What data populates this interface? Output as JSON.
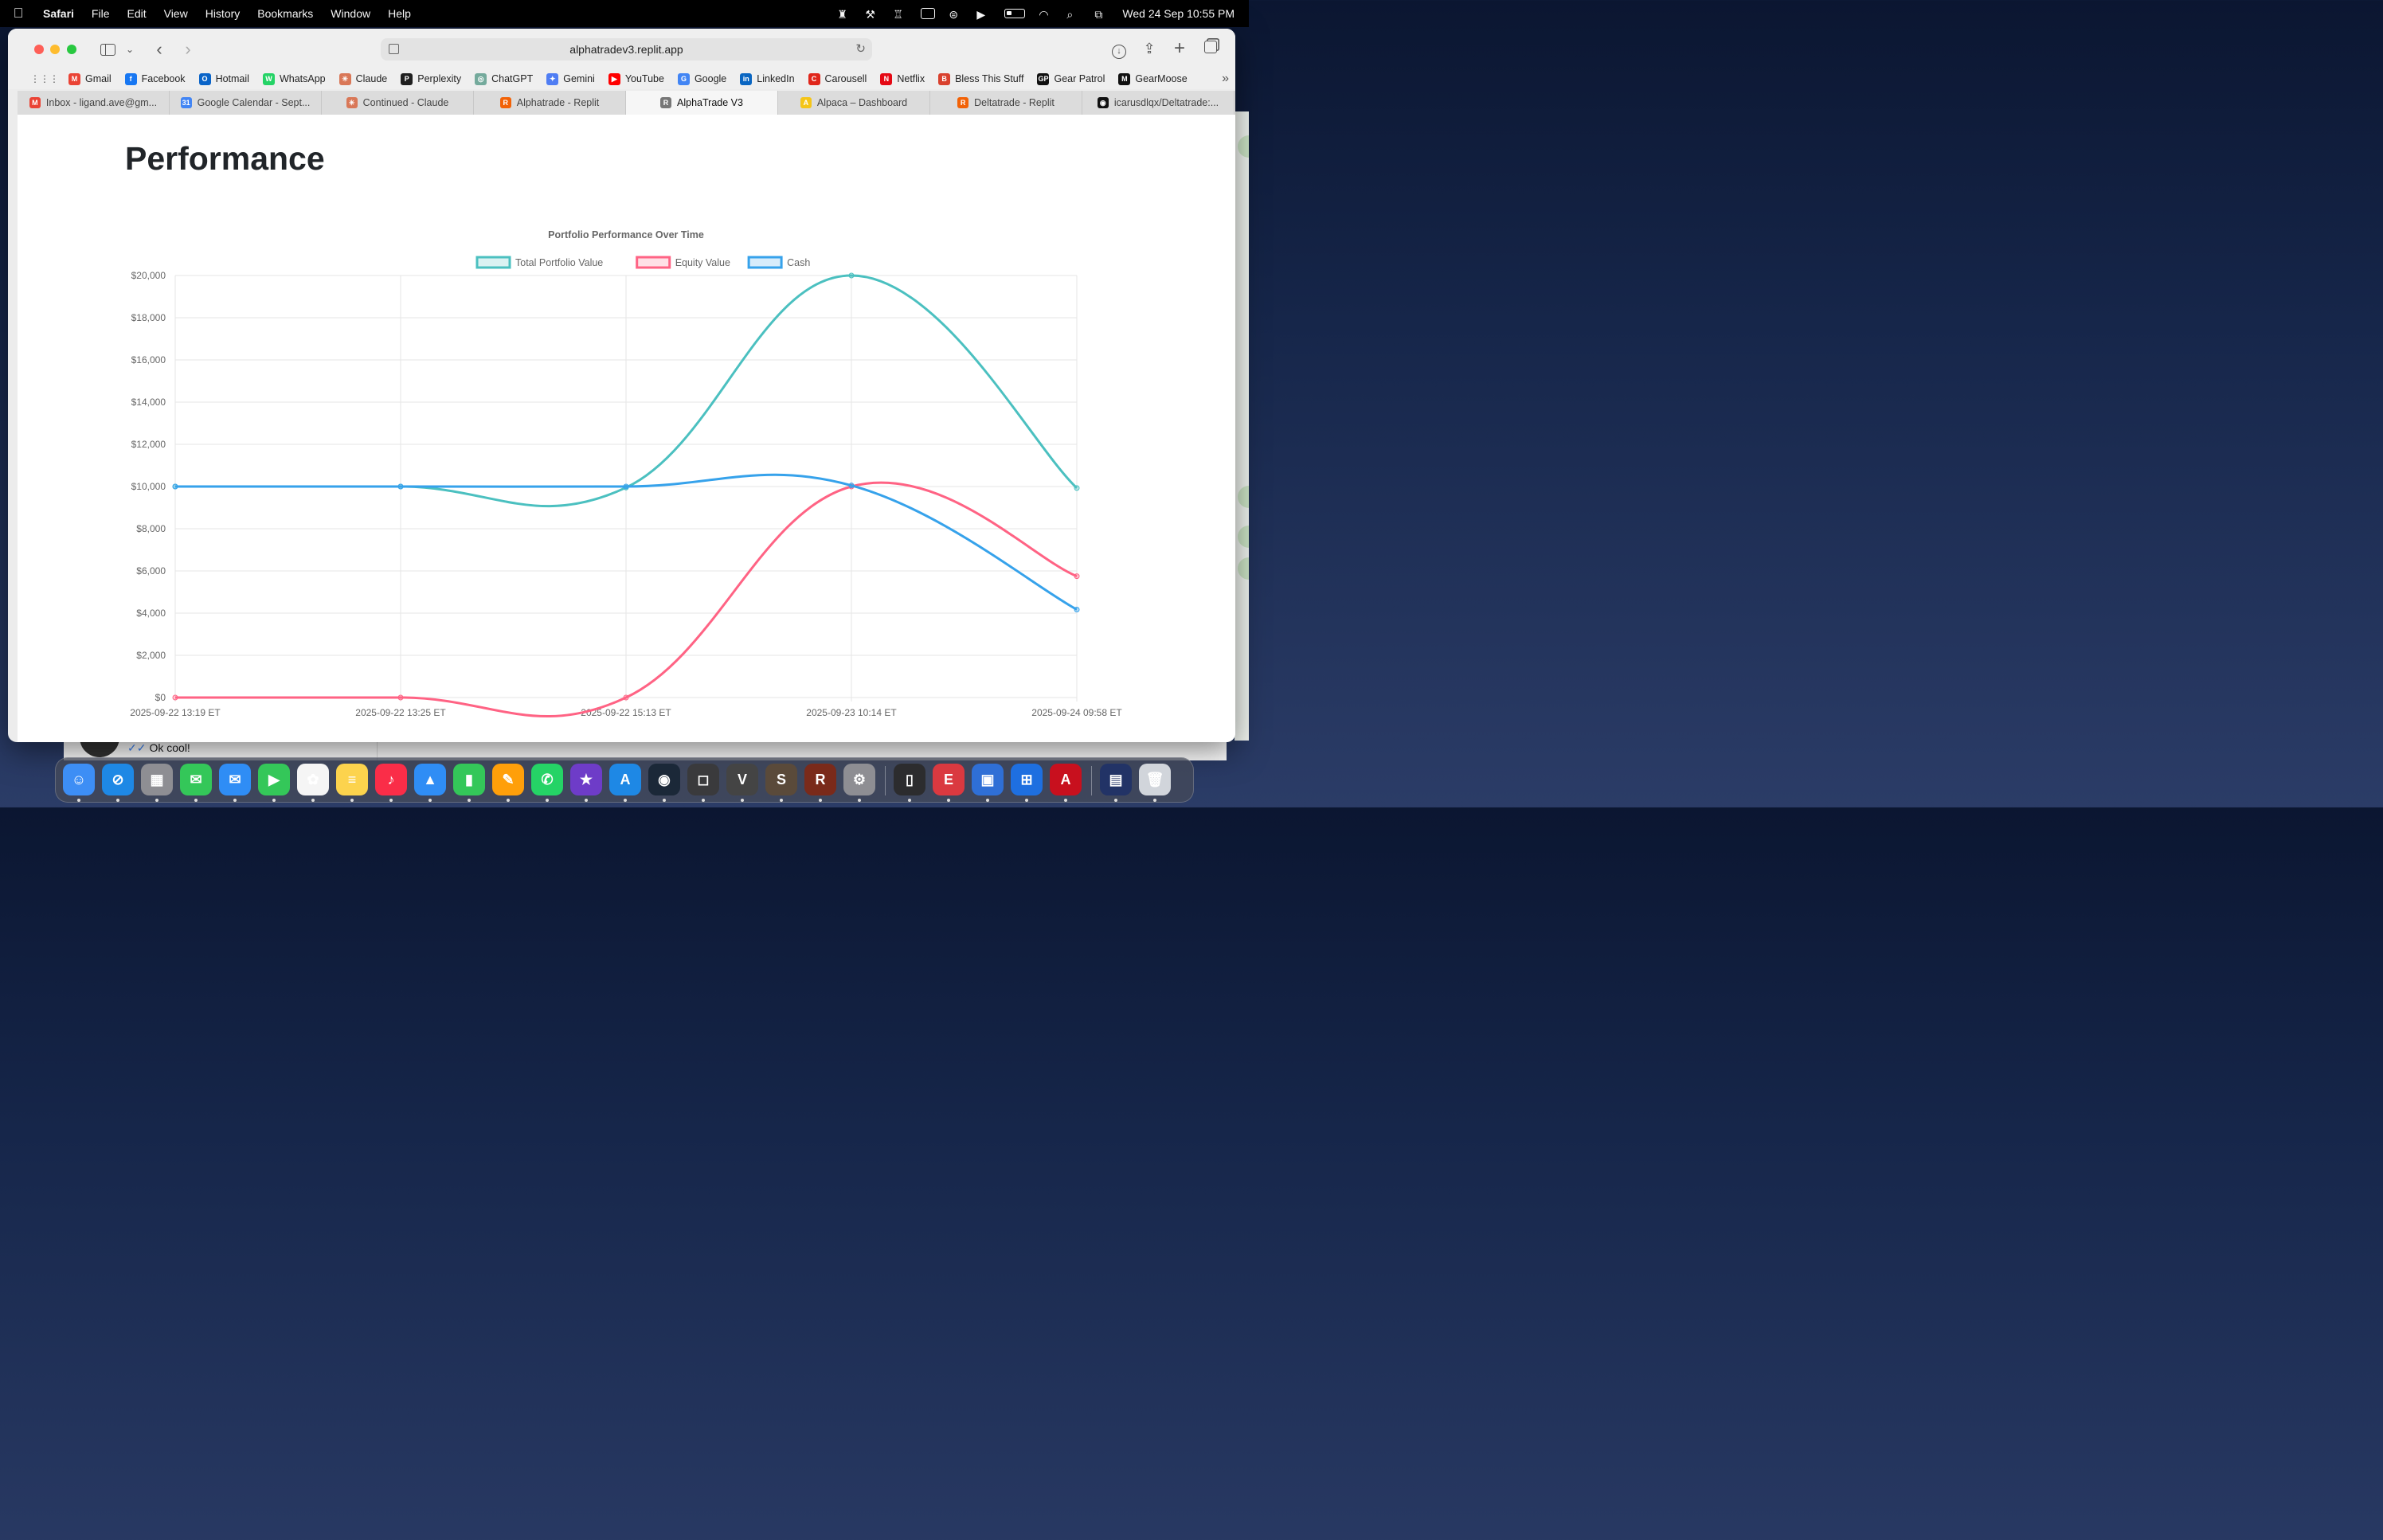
{
  "menubar": {
    "app_name": "Safari",
    "items": [
      "File",
      "Edit",
      "View",
      "History",
      "Bookmarks",
      "Window",
      "Help"
    ],
    "clock": "Wed 24 Sep  10:55 PM"
  },
  "browser": {
    "url": "alphatradev3.replit.app",
    "bookmarks": [
      {
        "label": "Gmail",
        "icon": "gmail-icon",
        "color": "#ea4335",
        "glyph": "M"
      },
      {
        "label": "Facebook",
        "icon": "facebook-icon",
        "color": "#1877f2",
        "glyph": "f"
      },
      {
        "label": "Hotmail",
        "icon": "outlook-icon",
        "color": "#0a64c8",
        "glyph": "O"
      },
      {
        "label": "WhatsApp",
        "icon": "whatsapp-icon",
        "color": "#25d366",
        "glyph": "W"
      },
      {
        "label": "Claude",
        "icon": "claude-icon",
        "color": "#d97757",
        "glyph": "✳"
      },
      {
        "label": "Perplexity",
        "icon": "perplexity-icon",
        "color": "#1f1f1f",
        "glyph": "P"
      },
      {
        "label": "ChatGPT",
        "icon": "chatgpt-icon",
        "color": "#74aa9c",
        "glyph": "◎"
      },
      {
        "label": "Gemini",
        "icon": "gemini-icon",
        "color": "#4f7df3",
        "glyph": "✦"
      },
      {
        "label": "YouTube",
        "icon": "youtube-icon",
        "color": "#ff0000",
        "glyph": "▶"
      },
      {
        "label": "Google",
        "icon": "google-icon",
        "color": "#4285f4",
        "glyph": "G"
      },
      {
        "label": "LinkedIn",
        "icon": "linkedin-icon",
        "color": "#0a66c2",
        "glyph": "in"
      },
      {
        "label": "Carousell",
        "icon": "carousell-icon",
        "color": "#e0261b",
        "glyph": "C"
      },
      {
        "label": "Netflix",
        "icon": "netflix-icon",
        "color": "#e50914",
        "glyph": "N"
      },
      {
        "label": "Bless This Stuff",
        "icon": "blessthisstuff-icon",
        "color": "#d9412e",
        "glyph": "B"
      },
      {
        "label": "Gear Patrol",
        "icon": "gearpatrol-icon",
        "color": "#111111",
        "glyph": "GP"
      },
      {
        "label": "GearMoose",
        "icon": "gearmoose-icon",
        "color": "#111111",
        "glyph": "M"
      }
    ],
    "tabs": [
      {
        "label": "Inbox - ligand.ave@gm...",
        "icon": "gmail-icon",
        "color": "#ea4335",
        "glyph": "M",
        "active": false
      },
      {
        "label": "Google Calendar - Sept...",
        "icon": "calendar-icon",
        "color": "#4285f4",
        "glyph": "31",
        "active": false
      },
      {
        "label": "Continued - Claude",
        "icon": "claude-icon",
        "color": "#d97757",
        "glyph": "✳",
        "active": false
      },
      {
        "label": "Alphatrade - Replit",
        "icon": "replit-icon",
        "color": "#f26207",
        "glyph": "R",
        "active": false
      },
      {
        "label": "AlphaTrade V3",
        "icon": "alphatrade-icon",
        "color": "#777777",
        "glyph": "R",
        "active": true
      },
      {
        "label": "Alpaca – Dashboard",
        "icon": "alpaca-icon",
        "color": "#f5c518",
        "glyph": "A",
        "active": false
      },
      {
        "label": "Deltatrade - Replit",
        "icon": "replit-icon",
        "color": "#f26207",
        "glyph": "R",
        "active": false
      },
      {
        "label": "icarusdlqx/Deltatrade:...",
        "icon": "github-icon",
        "color": "#111111",
        "glyph": "◉",
        "active": false
      }
    ]
  },
  "page": {
    "title": "Performance"
  },
  "background_app": {
    "message": "Ok cool!"
  },
  "chart_data": {
    "type": "line",
    "title": "Portfolio Performance Over Time",
    "x": [
      "2025-09-22 13:19 ET",
      "2025-09-22 13:25 ET",
      "2025-09-22 15:13 ET",
      "2025-09-23 10:14 ET",
      "2025-09-24 09:58 ET"
    ],
    "ylim": [
      0,
      20000
    ],
    "y_ticks": [
      "$0",
      "$2,000",
      "$4,000",
      "$6,000",
      "$8,000",
      "$10,000",
      "$12,000",
      "$14,000",
      "$16,000",
      "$18,000",
      "$20,000"
    ],
    "grid": true,
    "legend_position": "top",
    "series": [
      {
        "name": "Total Portfolio Value",
        "color": "#4bc0c0",
        "values": [
          10000,
          10000,
          9950,
          20000,
          9930
        ]
      },
      {
        "name": "Equity Value",
        "color": "#ff6384",
        "values": [
          0,
          0,
          0,
          10000,
          5750
        ]
      },
      {
        "name": "Cash",
        "color": "#36a2eb",
        "values": [
          10000,
          10000,
          10000,
          10050,
          4170
        ]
      }
    ]
  },
  "dock": {
    "apps": [
      {
        "name": "finder-icon",
        "color": "#3d8ef5",
        "glyph": "☺"
      },
      {
        "name": "safari-icon",
        "color": "#1e88e5",
        "glyph": "⊘"
      },
      {
        "name": "launchpad-icon",
        "color": "#8e8e93",
        "glyph": "▦"
      },
      {
        "name": "messages-icon",
        "color": "#34c759",
        "glyph": "✉"
      },
      {
        "name": "mail-icon",
        "color": "#2f8df5",
        "glyph": "✉"
      },
      {
        "name": "facetime-icon",
        "color": "#34c759",
        "glyph": "▶"
      },
      {
        "name": "photos-icon",
        "color": "#f5f5f5",
        "glyph": "✿"
      },
      {
        "name": "notes-icon",
        "color": "#fcd34d",
        "glyph": "≡"
      },
      {
        "name": "music-icon",
        "color": "#fa2d48",
        "glyph": "♪"
      },
      {
        "name": "keynote-icon",
        "color": "#2f8df5",
        "glyph": "▲"
      },
      {
        "name": "numbers-icon",
        "color": "#34c759",
        "glyph": "▮"
      },
      {
        "name": "pages-icon",
        "color": "#ff9f0a",
        "glyph": "✎"
      },
      {
        "name": "whatsapp-icon",
        "color": "#25d366",
        "glyph": "✆"
      },
      {
        "name": "imovie-icon",
        "color": "#6e3cc8",
        "glyph": "★"
      },
      {
        "name": "appstore-icon",
        "color": "#1e88e5",
        "glyph": "A"
      },
      {
        "name": "steam-icon",
        "color": "#1b2838",
        "glyph": "◉"
      },
      {
        "name": "screenshot-icon",
        "color": "#3a3a3c",
        "glyph": "◻"
      },
      {
        "name": "vlc-icon",
        "color": "#444444",
        "glyph": "V"
      },
      {
        "name": "shogun-icon",
        "color": "#5a4a3a",
        "glyph": "S"
      },
      {
        "name": "rome-icon",
        "color": "#7a2a1a",
        "glyph": "R"
      },
      {
        "name": "system-settings-icon",
        "color": "#8e8e93",
        "glyph": "⚙"
      },
      {
        "name": "iphone-mirroring-icon",
        "color": "#2c2c2e",
        "glyph": "▯"
      },
      {
        "name": "expressvpn-icon",
        "color": "#da3940",
        "glyph": "E"
      },
      {
        "name": "remote-desktop-icon",
        "color": "#2f6fd6",
        "glyph": "▣"
      },
      {
        "name": "windows-app-icon",
        "color": "#1e6fe0",
        "glyph": "⊞"
      },
      {
        "name": "acrobat-icon",
        "color": "#c8101e",
        "glyph": "A"
      },
      {
        "name": "downloads-stack-icon",
        "color": "#223366",
        "glyph": "▤"
      },
      {
        "name": "trash-icon",
        "color": "#d1d5db",
        "glyph": "🗑"
      }
    ]
  }
}
